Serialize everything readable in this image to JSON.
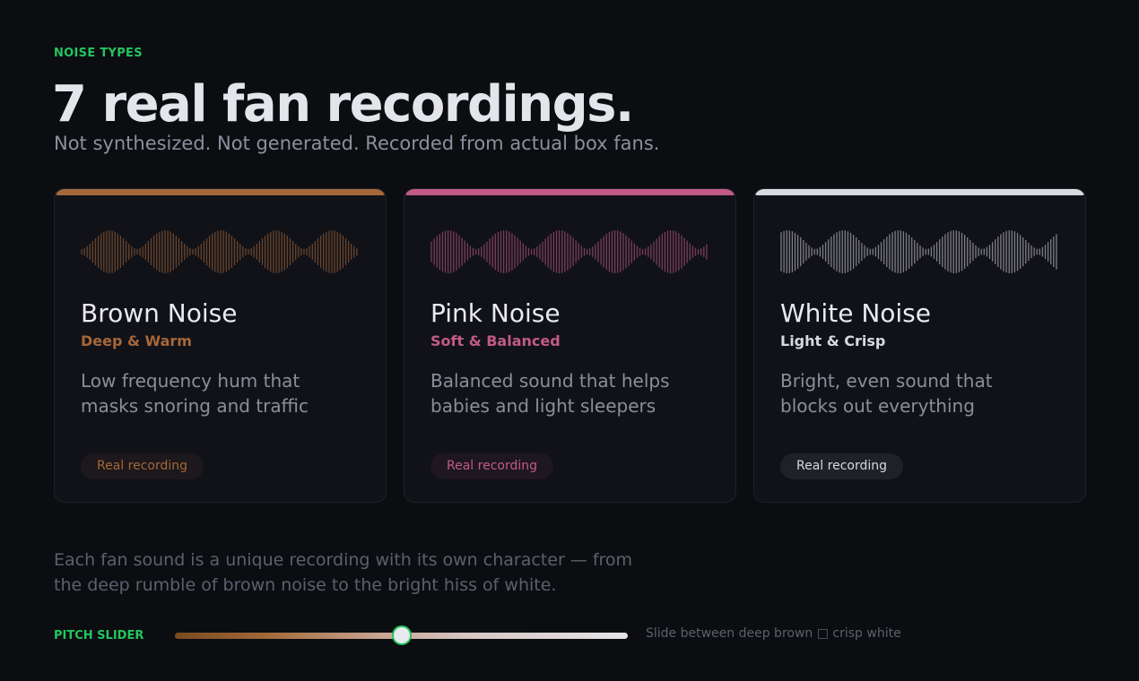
{
  "section": {
    "eyebrow": "NOISE TYPES",
    "title": "7 real fan recordings.",
    "subtitle": "Not synthesized. Not generated. Recorded from actual box fans."
  },
  "cards": [
    {
      "name": "Brown Noise",
      "tagline": "Deep & Warm",
      "description": "Low frequency hum that masks snoring and traffic",
      "badge": "Real recording",
      "accent_color": "#a5673a",
      "icon": "waveform-icon"
    },
    {
      "name": "Pink Noise",
      "tagline": "Soft & Balanced",
      "description": "Balanced sound that helps babies and light sleepers",
      "badge": "Real recording",
      "accent_color": "#c25b86",
      "icon": "waveform-icon"
    },
    {
      "name": "White Noise",
      "tagline": "Light & Crisp",
      "description": "Bright, even sound that blocks out everything",
      "badge": "Real recording",
      "accent_color": "#d8d9de",
      "icon": "waveform-icon"
    }
  ],
  "footer": {
    "text": "Each fan sound is a unique recording with its own character — from the deep rumble of brown noise to the bright hiss of white."
  },
  "pitch_slider": {
    "label": "PITCH SLIDER",
    "hint": "Slide between deep brown □ crisp white",
    "value_fraction": 0.5,
    "accent_color": "#22c55e"
  }
}
